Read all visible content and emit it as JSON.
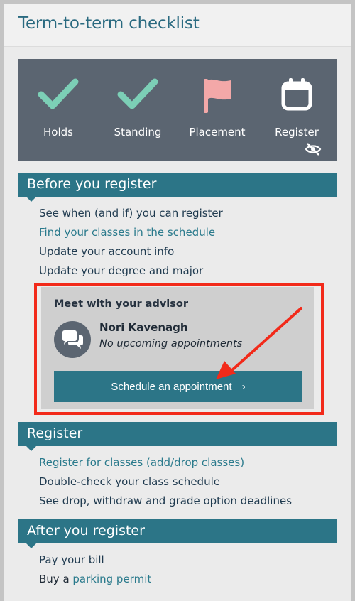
{
  "header": {
    "title": "Term-to-term checklist"
  },
  "status": {
    "items": [
      {
        "label": "Holds",
        "icon": "check-icon",
        "color": "#7ccfb6"
      },
      {
        "label": "Standing",
        "icon": "check-icon",
        "color": "#7ccfb6"
      },
      {
        "label": "Placement",
        "icon": "flag-icon",
        "color": "#f3a8a8"
      },
      {
        "label": "Register",
        "icon": "calendar-icon",
        "color": "#ffffff"
      }
    ],
    "hidden_icon": "eye-slash-icon"
  },
  "before": {
    "title": "Before you register",
    "links": [
      "See when (and if) you can register",
      "Find your classes in the schedule",
      "Update your account info",
      "Update your degree and major"
    ]
  },
  "advisor": {
    "title": "Meet with your advisor",
    "name": "Nori Kavenagh",
    "status": "No upcoming appointments",
    "button_label": "Schedule an appointment",
    "button_chevron": "›"
  },
  "register": {
    "title": "Register",
    "links": [
      "Register for classes (add/drop classes)",
      "Double-check your class schedule",
      "See drop, withdraw and grade option deadlines"
    ]
  },
  "after": {
    "title": "After you register",
    "links": [
      "Pay your bill"
    ],
    "parking_prefix": "Buy a",
    "parking_link": "parking permit"
  },
  "colors": {
    "accent": "#2c7587",
    "panel": "#5b6571",
    "highlight": "#f22a1a"
  }
}
